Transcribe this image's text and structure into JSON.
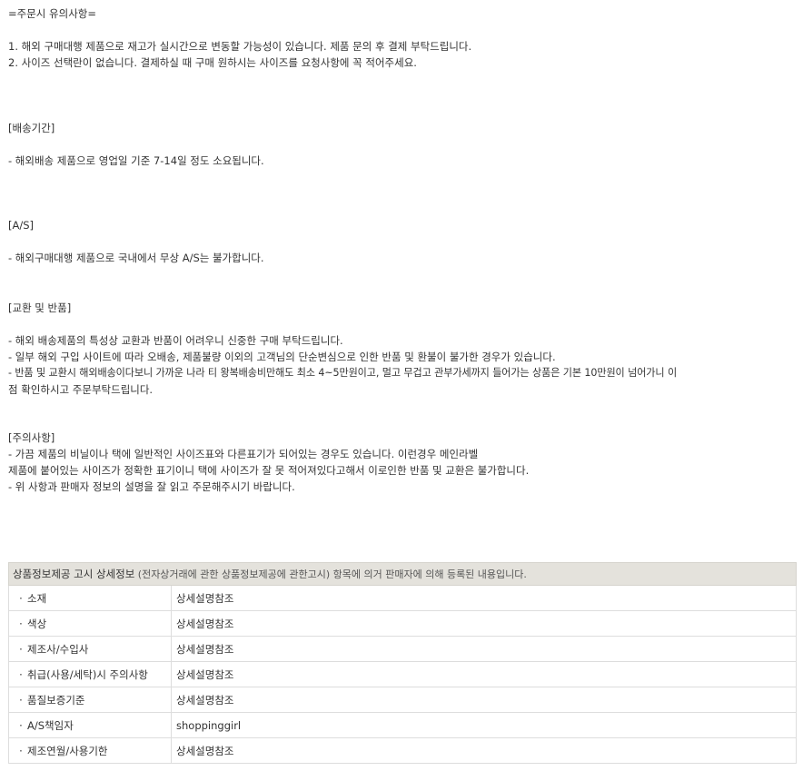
{
  "notice": {
    "title": "=주문시 유의사항=",
    "line1": "1. 해외 구매대행 제품으로 재고가 실시간으로 변동할 가능성이 있습니다. 제품 문의 후 결제 부탁드립니다.",
    "line2": "2. 사이즈 선택란이 없습니다. 결제하실 때 구매 원하시는 사이즈를 요청사항에 꼭 적어주세요.",
    "shipping_heading": "[배송기간]",
    "shipping_text": "- 해외배송 제품으로 영업일 기준 7-14일 정도 소요됩니다.",
    "as_heading": "[A/S]",
    "as_text": "- 해외구매대행 제품으로 국내에서 무상 A/S는 불가합니다.",
    "exchange_heading": "[교환 및 반품]",
    "exchange_1": "- 해외 배송제품의 특성상 교환과 반품이 어려우니 신중한 구매 부탁드립니다.",
    "exchange_2": "- 일부 해외 구입 사이트에 따라 오배송, 제품불량 이외의 고객님의 단순변심으로 인한 반품 및 환불이 불가한 경우가 있습니다.",
    "exchange_3": "- 반품 및 교환시 해외배송이다보니 가까운 나라 티 왕복배송비만해도 최소 4~5만원이고, 멀고 무겁고 관부가세까지 들어가는 상품은 기본 10만원이 넘어가니 이",
    "exchange_4": "점 확인하시고 주문부탁드립니다.",
    "caution_heading": "[주의사항]",
    "caution_1": "- 가끔 제품의 비닐이나 택에 일반적인 사이즈표와 다른표기가 되어있는 경우도 있습니다. 이런경우 메인라벨",
    "caution_2": "제품에 붙어있는 사이즈가 정확한 표기이니 택에 사이즈가 잘 못 적어져있다고해서 이로인한 반품 및 교환은 불가합니다.",
    "caution_3": "- 위 사항과 판매자 정보의 설명을 잘 읽고 주문해주시기 바랍니다."
  },
  "info": {
    "header_title": "상품정보제공 고시 상세정보",
    "header_sub": " (전자상거래에 관한 상품정보제공에 관한고시)",
    "header_tail": " 항목에 의거 판매자에 의해 등록된 내용입니다.",
    "bullet": "·",
    "rows": [
      {
        "key": "소재",
        "value": "상세설명참조"
      },
      {
        "key": "색상",
        "value": "상세설명참조"
      },
      {
        "key": "제조사/수입사",
        "value": "상세설명참조"
      },
      {
        "key": "취급(사용/세탁)시 주의사항",
        "value": "상세설명참조"
      },
      {
        "key": "품질보증기준",
        "value": "상세설명참조"
      },
      {
        "key": "A/S책임자",
        "value": "shoppinggirl"
      },
      {
        "key": "제조연월/사용기한",
        "value": "상세설명참조"
      }
    ]
  }
}
